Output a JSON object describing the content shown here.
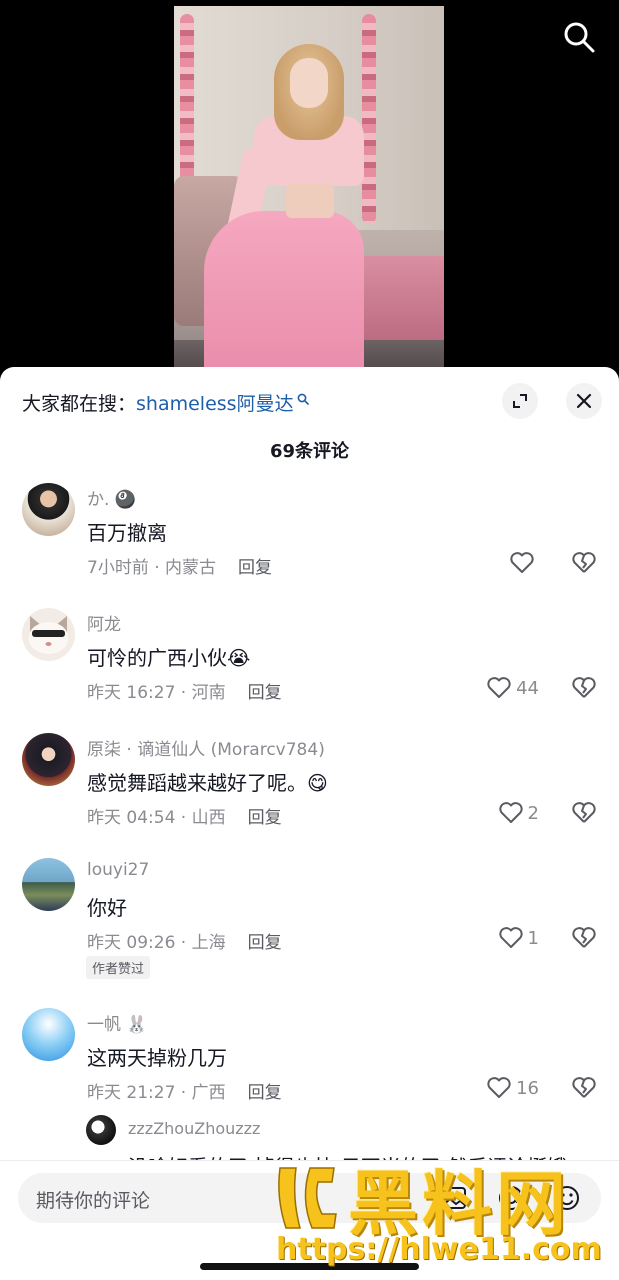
{
  "trending": {
    "prefix": "大家都在搜：",
    "query": "shameless阿曼达"
  },
  "comment_count": "69条评论",
  "comments": [
    {
      "user": "か.",
      "user_emoji": "🎱",
      "text": "百万撤离",
      "time_location": "7小时前 · 内蒙古",
      "reply": "回复",
      "likes": ""
    },
    {
      "user": "阿龙",
      "text": "可怜的广西小伙",
      "text_emoji": "😭",
      "time_location": "昨天 16:27 · 河南",
      "reply": "回复",
      "likes": "44"
    },
    {
      "user": "原柒 · 谪道仙人 (Morarcv784)",
      "text": "感觉舞蹈越来越好了呢。",
      "text_emoji": "😋",
      "time_location": "昨天 04:54 · 山西",
      "reply": "回复",
      "likes": "2"
    },
    {
      "user": "louyi27",
      "text": "你好",
      "time_location": "昨天 09:26 · 上海",
      "reply": "回复",
      "likes": "1",
      "badge": "作者赞过"
    },
    {
      "user": "一帆",
      "user_emoji": "🐰",
      "text": "这两天掉粉几万",
      "time_location": "昨天 21:27 · 广西",
      "reply": "回复",
      "likes": "16"
    }
  ],
  "sub_reply": {
    "user": "zzzZhouZhouzzz",
    "text": "没啥好看的了 掉得也快 只不当的了 然后评论挺饿"
  },
  "input": {
    "placeholder": "期待你的评论"
  },
  "watermark": {
    "title": "黑料网",
    "url": "https://hlwe11.com"
  },
  "colors": {
    "link": "#1f5ea8",
    "text": "#161823",
    "meta": "#8a8b91",
    "watermark": "#f6c21b"
  }
}
